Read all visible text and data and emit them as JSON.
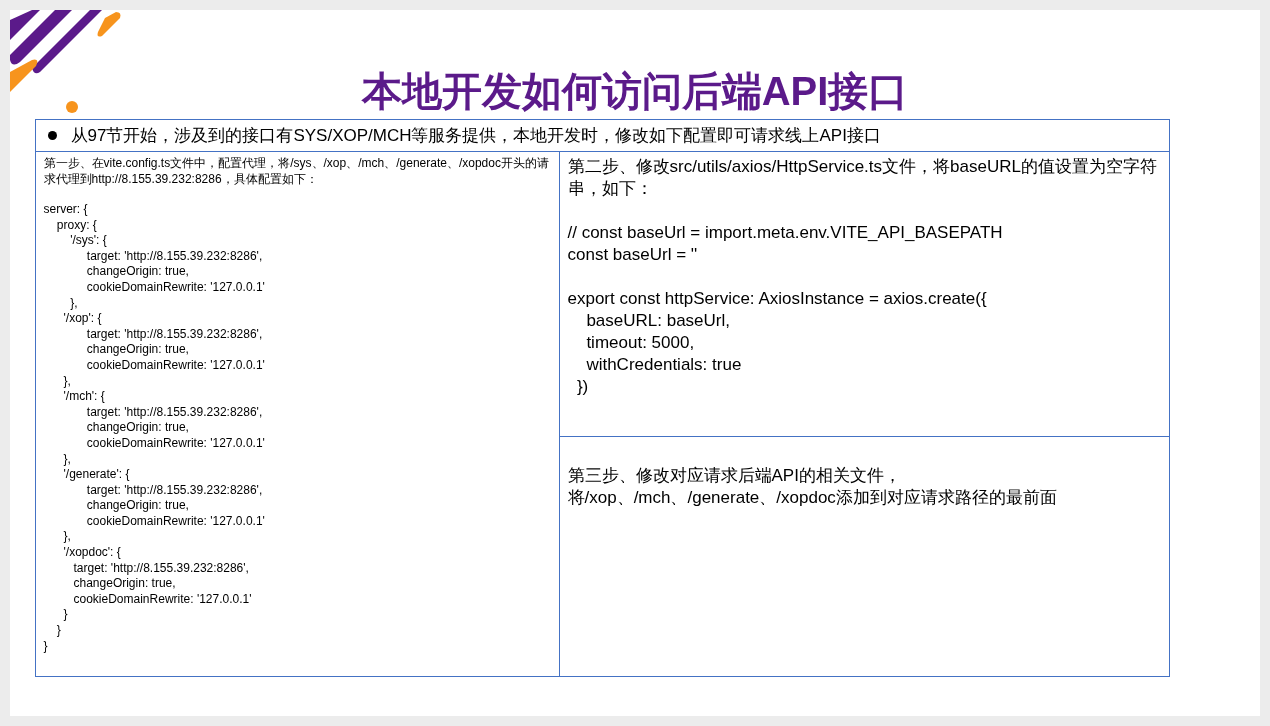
{
  "slide": {
    "title": "本地开发如何访问后端API接口",
    "bullet": "从97节开始，涉及到的接口有SYS/XOP/MCH等服务提供，本地开发时，修改如下配置即可请求线上API接口",
    "step_1": {
      "intro": "第一步、在vite.config.ts文件中，配置代理，将/sys、/xop、/mch、/generate、/xopdoc开头的请求代理到http://8.155.39.232:8286，具体配置如下：",
      "code": "server: {\n    proxy: {\n        '/sys': {\n             target: 'http://8.155.39.232:8286',\n             changeOrigin: true,\n             cookieDomainRewrite: '127.0.0.1'\n        },\n      '/xop': {\n             target: 'http://8.155.39.232:8286',\n             changeOrigin: true,\n             cookieDomainRewrite: '127.0.0.1'\n      },\n      '/mch': {\n             target: 'http://8.155.39.232:8286',\n             changeOrigin: true,\n             cookieDomainRewrite: '127.0.0.1'\n      },\n      '/generate': {\n             target: 'http://8.155.39.232:8286',\n             changeOrigin: true,\n             cookieDomainRewrite: '127.0.0.1'\n      },\n      '/xopdoc': {\n         target: 'http://8.155.39.232:8286',\n         changeOrigin: true,\n         cookieDomainRewrite: '127.0.0.1'\n      }\n    }\n}"
    },
    "step_2": {
      "intro": "第二步、修改src/utils/axios/HttpService.ts文件，将baseURL的值设置为空字符串，如下：",
      "code": "// const baseUrl = import.meta.env.VITE_API_BASEPATH\nconst baseUrl = ''\n\nexport const httpService: AxiosInstance = axios.create({\n    baseURL: baseUrl,\n    timeout: 5000,\n    withCredentials: true\n  })"
    },
    "step_3": {
      "intro": "第三步、修改对应请求后端API的相关文件，将/xop、/mch、/generate、/xopdoc添加到对应请求路径的最前面"
    }
  }
}
